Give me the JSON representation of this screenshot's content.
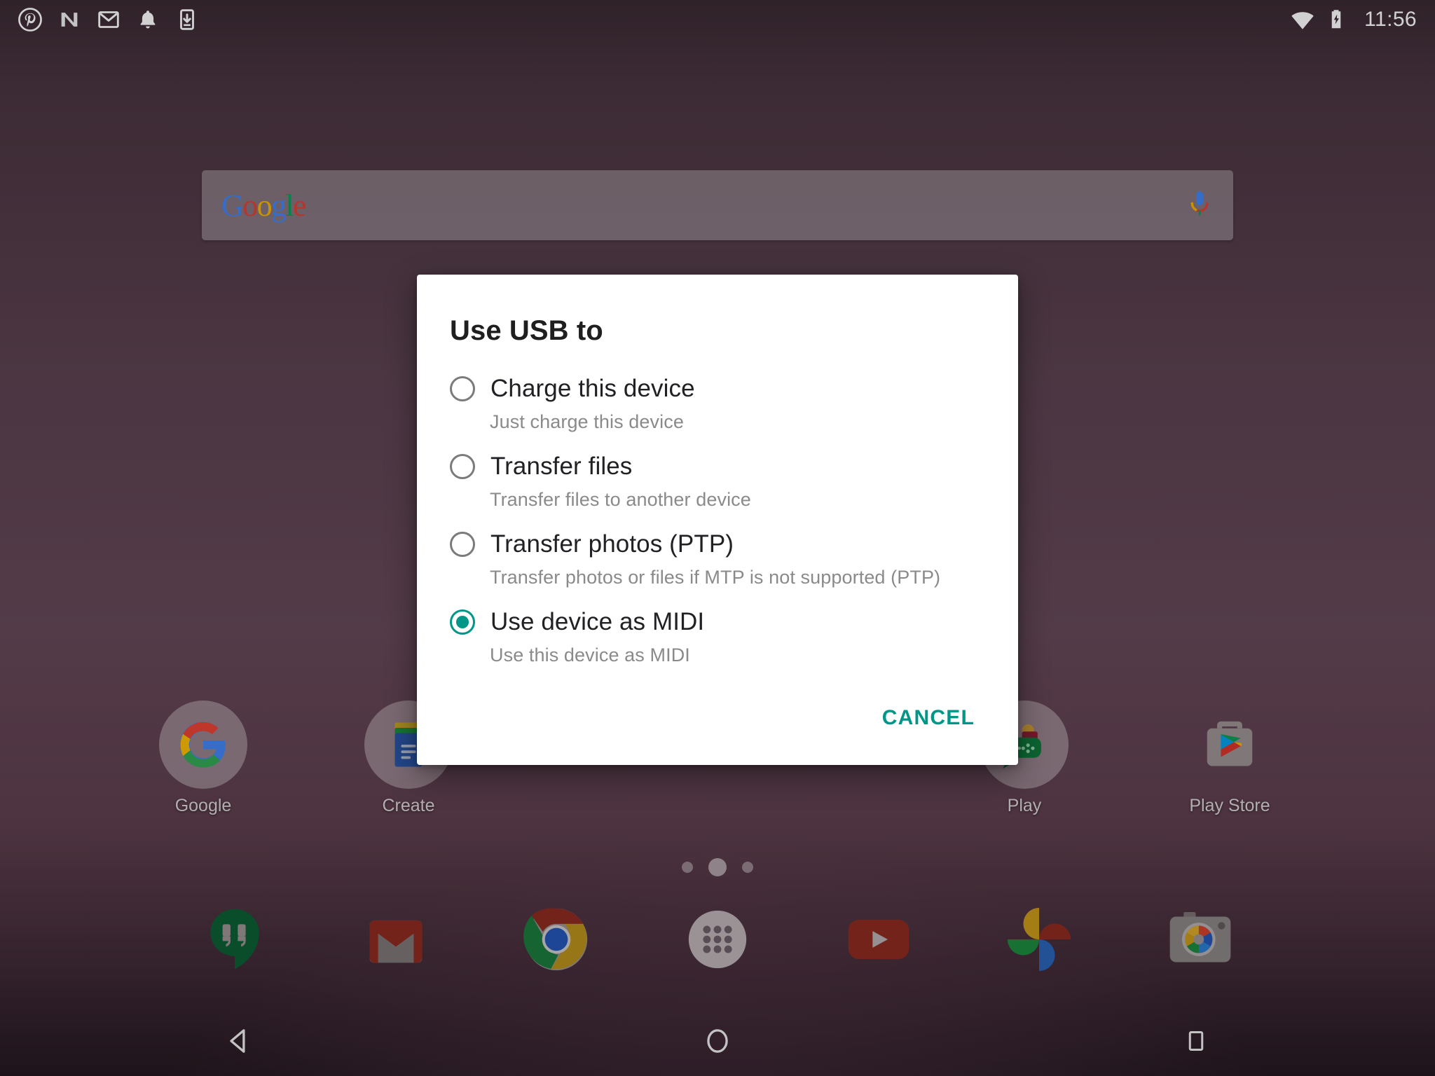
{
  "status_bar": {
    "time": "11:56",
    "left_icons": [
      {
        "name": "pinterest-icon"
      },
      {
        "name": "nova-launcher-icon"
      },
      {
        "name": "gmail-icon"
      },
      {
        "name": "notification-bell-icon"
      },
      {
        "name": "download-to-device-icon"
      }
    ],
    "right_icons": [
      {
        "name": "wifi-icon"
      },
      {
        "name": "battery-charging-icon"
      }
    ]
  },
  "search_widget": {
    "logo_letters": [
      "G",
      "o",
      "o",
      "g",
      "l",
      "e"
    ],
    "mic_icon": "microphone-icon"
  },
  "home_screen": {
    "apps": [
      {
        "label": "Google",
        "icon": "google-folder-icon",
        "is_folder": true
      },
      {
        "label": "Create",
        "icon": "google-docs-icon",
        "is_folder": true
      },
      {
        "label": "Play",
        "icon": "play-games-folder-icon",
        "is_folder": true
      },
      {
        "label": "Play Store",
        "icon": "play-store-icon",
        "is_folder": false
      }
    ],
    "page_dots": {
      "count": 3,
      "active_index": 1
    },
    "dock": [
      {
        "name": "hangouts-icon"
      },
      {
        "name": "gmail-icon"
      },
      {
        "name": "chrome-icon"
      },
      {
        "name": "app-drawer-icon"
      },
      {
        "name": "youtube-icon"
      },
      {
        "name": "google-photos-icon"
      },
      {
        "name": "camera-icon"
      }
    ]
  },
  "nav_bar": {
    "back": "back-triangle-icon",
    "home": "home-circle-icon",
    "recents": "recents-square-icon"
  },
  "dialog": {
    "title": "Use USB to",
    "options": [
      {
        "title": "Charge this device",
        "subtitle": "Just charge this device",
        "selected": false
      },
      {
        "title": "Transfer files",
        "subtitle": "Transfer files to another device",
        "selected": false
      },
      {
        "title": "Transfer photos (PTP)",
        "subtitle": "Transfer photos or files if MTP is not supported (PTP)",
        "selected": false
      },
      {
        "title": "Use device as MIDI",
        "subtitle": "Use this device as MIDI",
        "selected": true
      }
    ],
    "cancel_label": "CANCEL"
  },
  "colors": {
    "accent_teal": "#009688",
    "wallpaper_mauve": "#5e4352",
    "dialog_bg": "#ffffff",
    "title_text": "#1f1f1f",
    "subtitle_text": "#8a8a8a"
  }
}
